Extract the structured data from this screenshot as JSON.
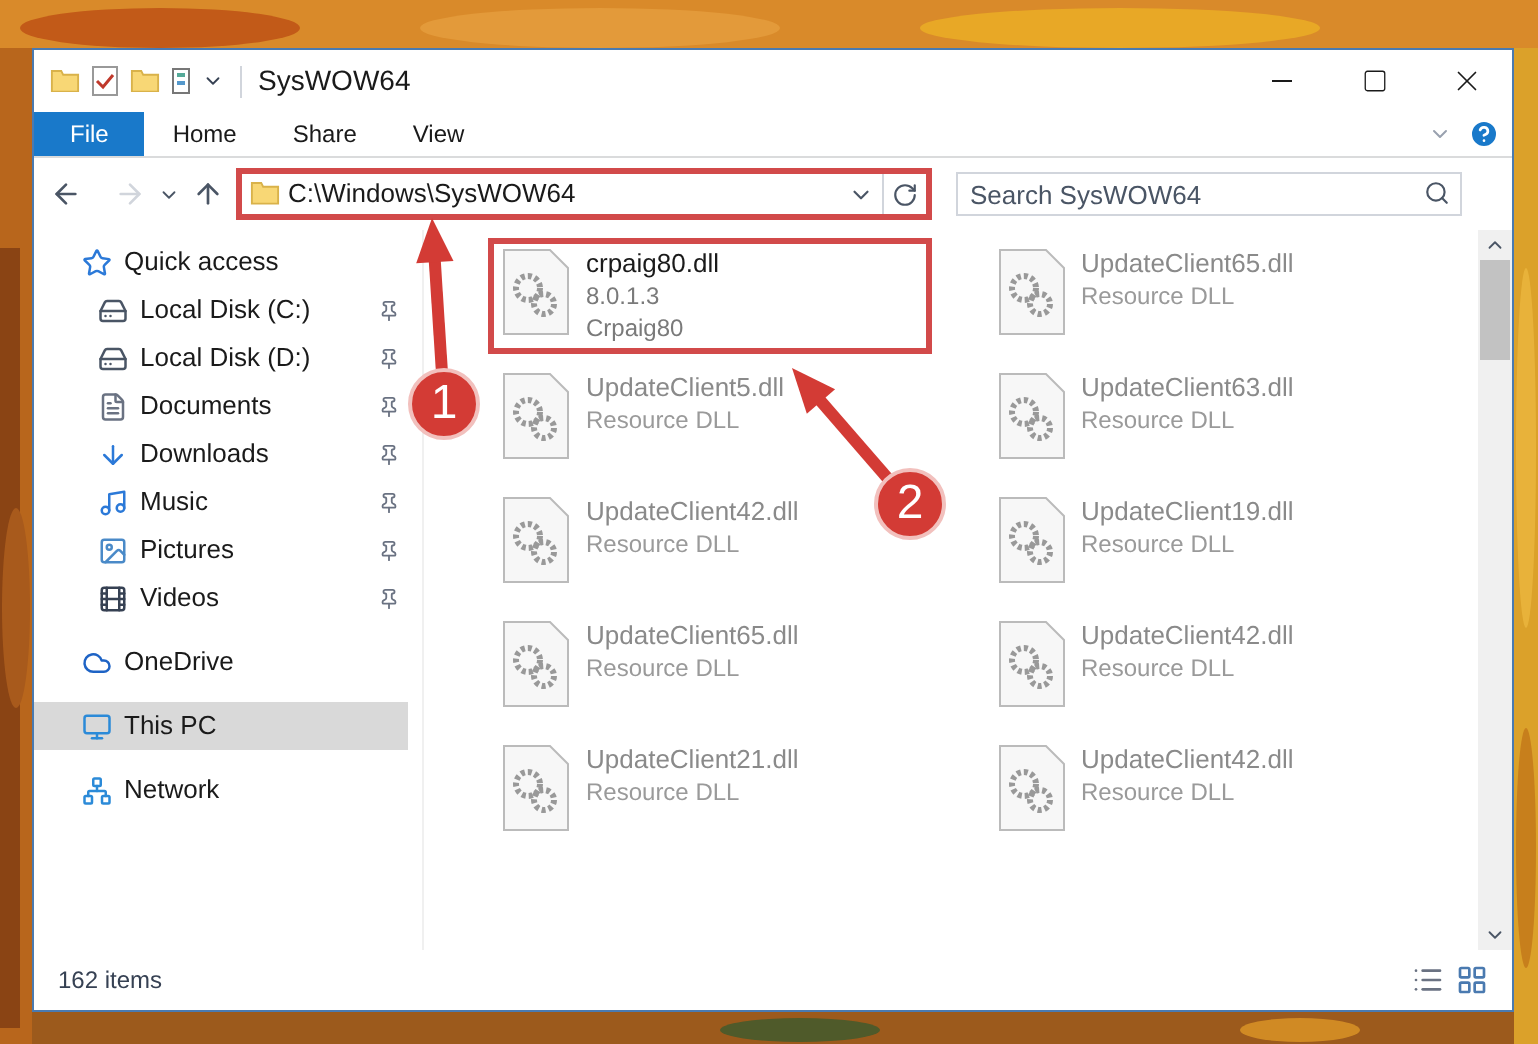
{
  "window": {
    "title": "SysWOW64"
  },
  "ribbon": {
    "tabs": [
      {
        "label": "File",
        "selected": true
      },
      {
        "label": "Home",
        "selected": false
      },
      {
        "label": "Share",
        "selected": false
      },
      {
        "label": "View",
        "selected": false
      }
    ]
  },
  "address": {
    "path": "C:\\Windows\\SysWOW64",
    "highlighted": true
  },
  "search": {
    "placeholder": "Search SysWOW64"
  },
  "sidebar": {
    "items": [
      {
        "label": "Quick access",
        "kind": "star",
        "selected": false,
        "children": [
          {
            "label": "Local Disk (C:)",
            "kind": "drive",
            "pinned": true
          },
          {
            "label": "Local Disk (D:)",
            "kind": "drive",
            "pinned": true
          },
          {
            "label": "Documents",
            "kind": "document",
            "pinned": true
          },
          {
            "label": "Downloads",
            "kind": "download",
            "pinned": true
          },
          {
            "label": "Music",
            "kind": "music",
            "pinned": true
          },
          {
            "label": "Pictures",
            "kind": "pictures",
            "pinned": true
          },
          {
            "label": "Videos",
            "kind": "videos",
            "pinned": true
          }
        ]
      },
      {
        "label": "OneDrive",
        "kind": "cloud",
        "selected": false
      },
      {
        "label": "This PC",
        "kind": "pc",
        "selected": true
      },
      {
        "label": "Network",
        "kind": "network",
        "selected": false
      }
    ]
  },
  "files": [
    {
      "name": "crpaig80.dll",
      "lines": [
        "8.0.1.3",
        "Crpaig80"
      ],
      "highlighted": true,
      "blurred": false
    },
    {
      "name": "UpdateClient65.dll",
      "lines": [
        "Resource DLL"
      ],
      "highlighted": false,
      "blurred": true
    },
    {
      "name": "UpdateClient5.dll",
      "lines": [
        "Resource DLL"
      ],
      "highlighted": false,
      "blurred": true
    },
    {
      "name": "UpdateClient63.dll",
      "lines": [
        "Resource DLL"
      ],
      "highlighted": false,
      "blurred": true
    },
    {
      "name": "UpdateClient42.dll",
      "lines": [
        "Resource DLL"
      ],
      "highlighted": false,
      "blurred": true
    },
    {
      "name": "UpdateClient19.dll",
      "lines": [
        "Resource DLL"
      ],
      "highlighted": false,
      "blurred": true
    },
    {
      "name": "UpdateClient65.dll",
      "lines": [
        "Resource DLL"
      ],
      "highlighted": false,
      "blurred": true
    },
    {
      "name": "UpdateClient42.dll",
      "lines": [
        "Resource DLL"
      ],
      "highlighted": false,
      "blurred": true
    },
    {
      "name": "UpdateClient21.dll",
      "lines": [
        "Resource DLL"
      ],
      "highlighted": false,
      "blurred": true
    },
    {
      "name": "UpdateClient42.dll",
      "lines": [
        "Resource DLL"
      ],
      "highlighted": false,
      "blurred": true
    }
  ],
  "status_bar": {
    "count": "162 items"
  },
  "callouts": [
    {
      "number": "1"
    },
    {
      "number": "2"
    }
  ]
}
